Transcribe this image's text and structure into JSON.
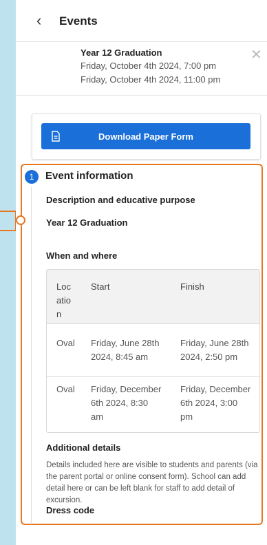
{
  "header": {
    "back_icon": "chevron-left-icon",
    "title": "Events"
  },
  "event": {
    "title": "Year 12 Graduation",
    "start": "Friday, October 4th 2024, 7:00 pm",
    "end": "Friday, October 4th 2024, 11:00 pm",
    "close_icon": "close-icon"
  },
  "download": {
    "label": "Download Paper Form",
    "icon": "document-icon"
  },
  "step": {
    "number": "1",
    "title": "Event information",
    "description_label": "Description and educative purpose",
    "description_value": "Year 12 Graduation",
    "when_label": "When and where",
    "table": {
      "headers": [
        "Location",
        "Start",
        "Finish"
      ],
      "header_lines": [
        [
          "Loc",
          "atio",
          "n"
        ],
        [
          "Start"
        ],
        [
          "Finish"
        ]
      ],
      "rows": [
        {
          "location": "Oval",
          "start": [
            "Friday, June 28th",
            "2024, 8:45 am"
          ],
          "finish": [
            "Friday, June 28th",
            "2024, 2:50 pm"
          ]
        },
        {
          "location": "Oval",
          "start": [
            "Friday, December",
            "6th 2024, 8:30",
            "am"
          ],
          "finish": [
            "Friday, December",
            "6th 2024, 3:00",
            "pm"
          ]
        }
      ]
    },
    "additional_label": "Additional details",
    "additional_text": "Details included here are visible to students and parents (via the parent portal or online consent form). School can add detail here or can be left blank for staff to add detail of excursion.",
    "dress_label": "Dress code"
  },
  "colors": {
    "accent": "#1a6fd8",
    "highlight": "#e87722",
    "background": "#bfe3ee"
  }
}
